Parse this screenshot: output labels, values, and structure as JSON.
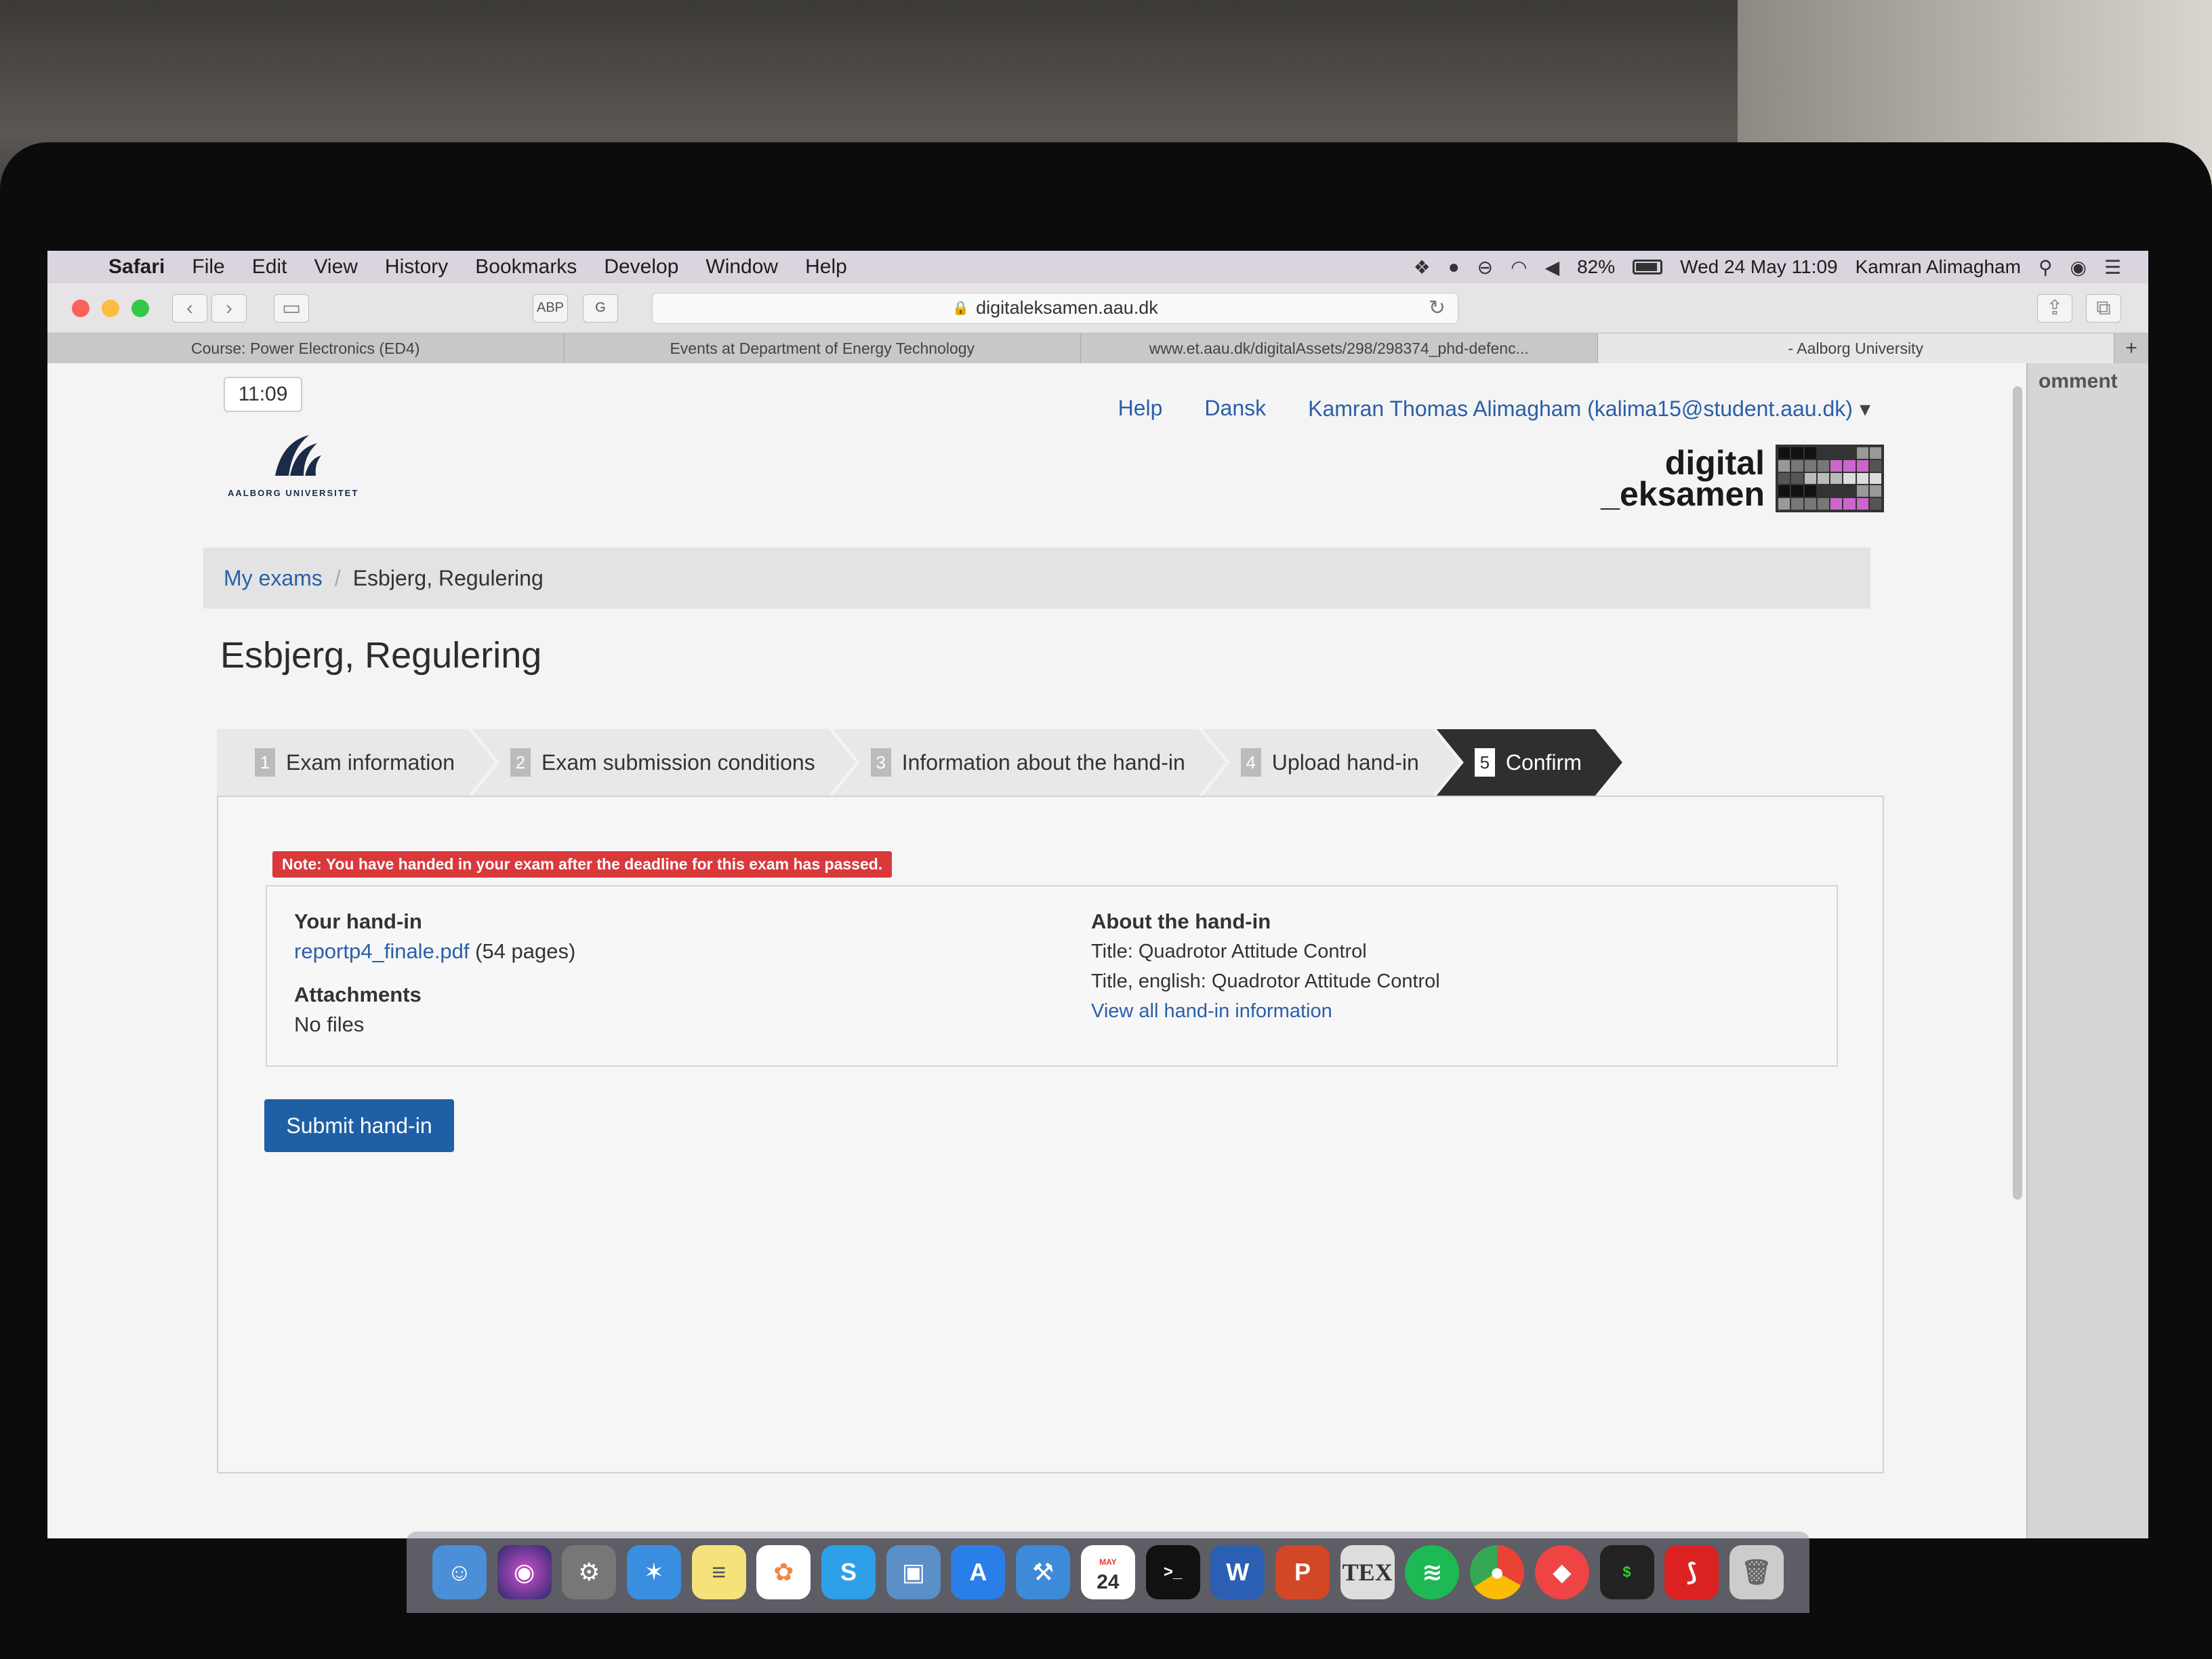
{
  "menubar": {
    "app": "Safari",
    "items": [
      "File",
      "Edit",
      "View",
      "History",
      "Bookmarks",
      "Develop",
      "Window",
      "Help"
    ],
    "battery": "82%",
    "datetime": "Wed 24 May  11:09",
    "user": "Kamran Alimagham"
  },
  "toolbar": {
    "url": "digitaleksamen.aau.dk",
    "ext_abp": "ABP",
    "ext_grammarly": "G"
  },
  "tabs": [
    {
      "label": "Course: Power Electronics (ED4)"
    },
    {
      "label": "Events at Department of Energy Technology"
    },
    {
      "label": "www.et.aau.dk/digitalAssets/298/298374_phd-defenc..."
    },
    {
      "label": "- Aalborg University"
    }
  ],
  "side_strip_text": "omment",
  "page": {
    "clock": "11:09",
    "logo_text": "AALBORG UNIVERSITET",
    "top_links": {
      "help": "Help",
      "language": "Dansk",
      "user": "Kamran Thomas Alimagham (kalima15@student.aau.dk)",
      "user_caret": "▾"
    },
    "de_logo_line1": "digital",
    "de_logo_line2": "_eksamen",
    "breadcrumb": {
      "link": "My exams",
      "sep": "/",
      "current": "Esbjerg, Regulering"
    },
    "title": "Esbjerg, Regulering",
    "steps": [
      {
        "num": "1",
        "label": "Exam information"
      },
      {
        "num": "2",
        "label": "Exam submission conditions"
      },
      {
        "num": "3",
        "label": "Information about the hand-in"
      },
      {
        "num": "4",
        "label": "Upload hand-in"
      },
      {
        "num": "5",
        "label": "Confirm"
      }
    ],
    "note": "Note: You have handed in your exam after the deadline for this exam has passed.",
    "your_handin": {
      "heading": "Your hand-in",
      "file": "reportp4_finale.pdf",
      "pages": " (54 pages)",
      "attachments_heading": "Attachments",
      "attachments_value": "No files"
    },
    "about_handin": {
      "heading": "About the hand-in",
      "title": "Title: Quadrotor Attitude Control",
      "title_en": "Title, english: Quadrotor Attitude Control",
      "view_all": "View all hand-in information"
    },
    "submit_label": "Submit hand-in"
  },
  "dock": {
    "calendar_month": "MAY",
    "calendar_day": "24",
    "terminal_prompt": ">_",
    "word": "W",
    "powerpoint": "P",
    "tex": "TEX",
    "skype": "S"
  },
  "colors": {
    "accent": "#2a5fa8",
    "submit": "#1f5fa6",
    "note": "#d9393b",
    "active_step": "#2f2f2f"
  }
}
